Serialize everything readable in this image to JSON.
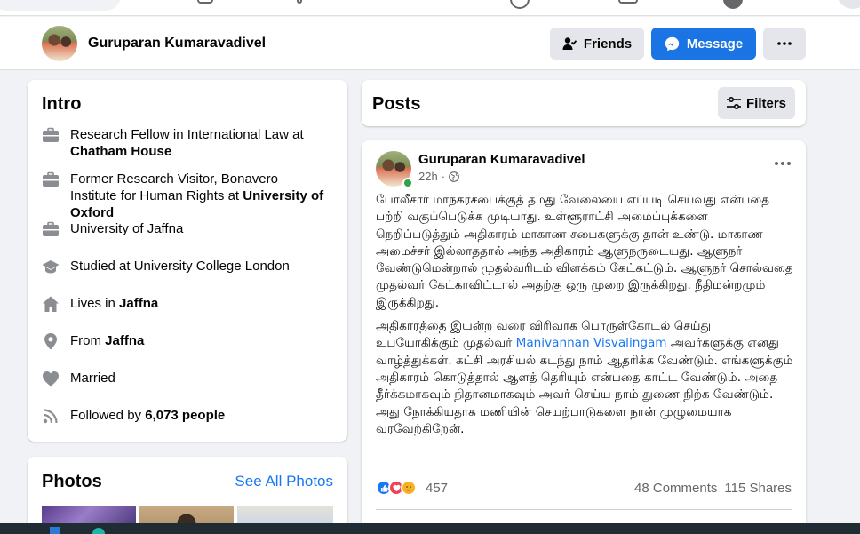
{
  "profile": {
    "name": "Guruparan Kumaravadivel",
    "friends_label": "Friends",
    "message_label": "Message"
  },
  "intro": {
    "title": "Intro",
    "items": [
      {
        "icon": "briefcase-icon",
        "text": "Research Fellow in International Law at ",
        "bold": "Chatham House"
      },
      {
        "icon": "briefcase-icon",
        "text": "Former Research Visitor, Bonavero Institute for Human Rights at ",
        "bold": "University of Oxford"
      },
      {
        "icon": "briefcase-icon",
        "text": "University of Jaffna",
        "bold": ""
      },
      {
        "icon": "graduation-cap-icon",
        "text": "Studied at University College London",
        "bold": ""
      },
      {
        "icon": "home-icon",
        "text": "Lives in ",
        "bold": "Jaffna"
      },
      {
        "icon": "location-pin-icon",
        "text": "From ",
        "bold": "Jaffna"
      },
      {
        "icon": "heart-icon",
        "text": "Married",
        "bold": ""
      },
      {
        "icon": "rss-icon",
        "text": "Followed by ",
        "bold": "6,073 people"
      }
    ]
  },
  "photos": {
    "title": "Photos",
    "see_all": "See All Photos"
  },
  "posts": {
    "title": "Posts",
    "filters_label": "Filters"
  },
  "post": {
    "author": "Guruparan Kumaravadivel",
    "time": "22h",
    "paragraph1": "போலீசார் மாநகரசபைக்குத் தமது வேலையை எப்படி செய்வது என்பதை பற்றி வகுப்பெடுக்க முடியாது. உள்ளூராட்சி அமைப்புக்களை நெறிப்படுத்தும் அதிகாரம் மாகாண சபைகளுக்கு தான் உண்டு. மாகாண அமைச்சர் இல்லாததால் அந்த அதிகாரம் ஆளுநருடையது. ஆளுநர் வேண்டுமென்றால் முதல்வரிடம் விளக்கம் கேட்கட்டும். ஆளுநர் சொல்வதை முதல்வர் கேட்காவிட்டால் அதற்கு ஒரு முறை இருக்கிறது. நீதிமன்றமும் இருக்கிறது.",
    "paragraph2_pre": "அதிகாரத்தை இயன்ற வரை விரிவாக பொருள்கோடல் செய்து உபயோகிக்கும் முதல்வர் ",
    "mention": "Manivannan Visvalingam",
    "paragraph2_post": " அவர்களுக்கு எனது வாழ்த்துக்கள். கட்சி அரசியல் கடந்து நாம் ஆதரிக்க வேண்டும். எங்களுக்கும் அதிகாரம் கொடுத்தால் ஆளத் தெரியும் என்பதை காட்ட வேண்டும். அதை தீர்க்கமாகவும் நிதானமாகவும் அவர் செய்ய நாம் துணை நிற்க வேண்டும். அது நோக்கியதாக மணியின் செயற்பாடுகளை நான் முழுமையாக வரவேற்கிறேன்.",
    "reaction_count": "457",
    "comments": "48 Comments",
    "shares": "115 Shares"
  },
  "colors": {
    "accent": "#1b74e4",
    "link": "#1877f2",
    "online": "#31a24c"
  }
}
